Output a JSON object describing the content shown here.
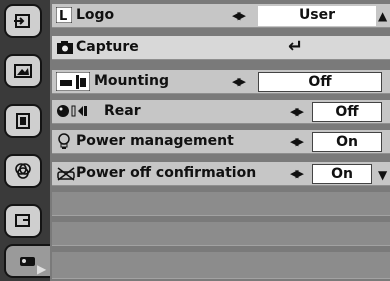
{
  "sidebar": {
    "tabs": [
      {
        "icon": "input-icon"
      },
      {
        "icon": "picture-icon"
      },
      {
        "icon": "image-adjust-icon"
      },
      {
        "icon": "color-icon"
      },
      {
        "icon": "screen-icon"
      },
      {
        "icon": "setting-icon"
      }
    ],
    "active_index": 5,
    "pointer_glyph": "▶"
  },
  "menu": {
    "rows": [
      {
        "label": "Logo",
        "value": "User",
        "icon": "logo-icon",
        "arrows": "◀▶"
      },
      {
        "label": "Capture",
        "icon": "capture-icon",
        "enter_glyph": "↵"
      },
      {
        "label": "Mounting",
        "value": "Off",
        "icon": "mounting-icon",
        "arrows": "◀▶"
      },
      {
        "label": "Rear",
        "value": "Off",
        "icon": "rear-icon",
        "arrows": "◀▶"
      },
      {
        "label": "Power management",
        "value": "On",
        "icon": "power-management-icon",
        "arrows": "◀▶"
      },
      {
        "label": "Power off confirmation",
        "value": "On",
        "icon": "power-off-confirmation-icon",
        "arrows": "◀▶"
      }
    ],
    "scroll_up": "▲",
    "scroll_down": "▼"
  }
}
